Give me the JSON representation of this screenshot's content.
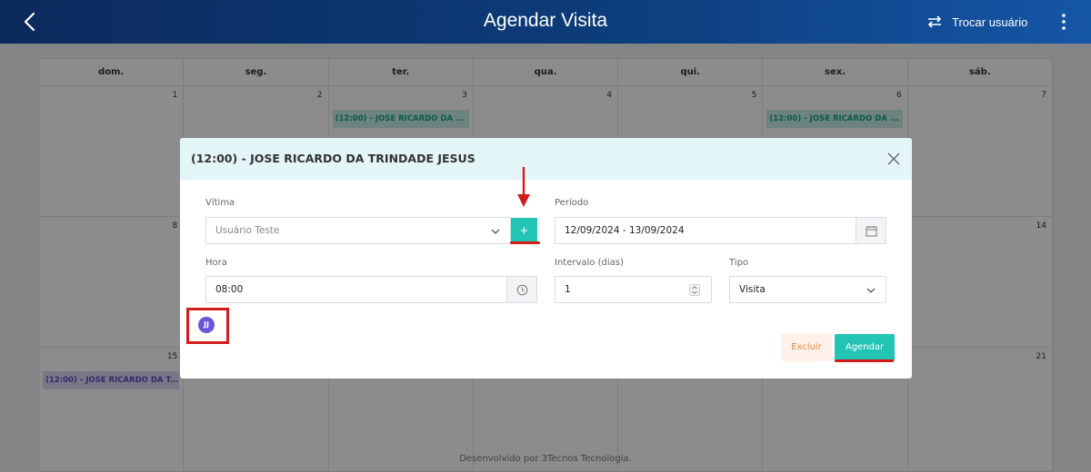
{
  "header": {
    "title": "Agendar Visita",
    "switch_user_label": "Trocar usuário"
  },
  "calendar": {
    "weekdays": [
      "dom.",
      "seg.",
      "ter.",
      "qua.",
      "qui.",
      "sex.",
      "sáb."
    ],
    "week1": [
      "1",
      "2",
      "3",
      "4",
      "5",
      "6",
      "7"
    ],
    "week2": {
      "first": "8",
      "last": "14"
    },
    "week3": {
      "first": "15",
      "last": "21"
    },
    "events": {
      "tue3": "(12:00) - JOSE RICARDO DA ...",
      "fri6": "(12:00) - JOSE RICARDO DA ...",
      "sun15": "(12:00) - JOSE RICARDO DA T..."
    },
    "colors": {
      "event_teal": "#14a08a",
      "event_purple": "#5a4fc4"
    }
  },
  "modal": {
    "title": "(12:00) - JOSE RICARDO DA TRINDADE JESUS",
    "victim_label": "Vítima",
    "victim_value": "Usuário Teste",
    "add_label": "+",
    "period_label": "Período",
    "period_value": "12/09/2024 - 13/09/2024",
    "hour_label": "Hora",
    "hour_value": "08:00",
    "interval_label": "Intervalo (dias)",
    "interval_value": "1",
    "type_label": "Tipo",
    "type_value": "Visita",
    "avatar_initials": "JJ",
    "delete_label": "Excluir",
    "schedule_label": "Agendar",
    "accent_color": "#22c4b4"
  },
  "footer": {
    "developed_by": "Desenvolvido por 3Tecnos Tecnologia."
  }
}
